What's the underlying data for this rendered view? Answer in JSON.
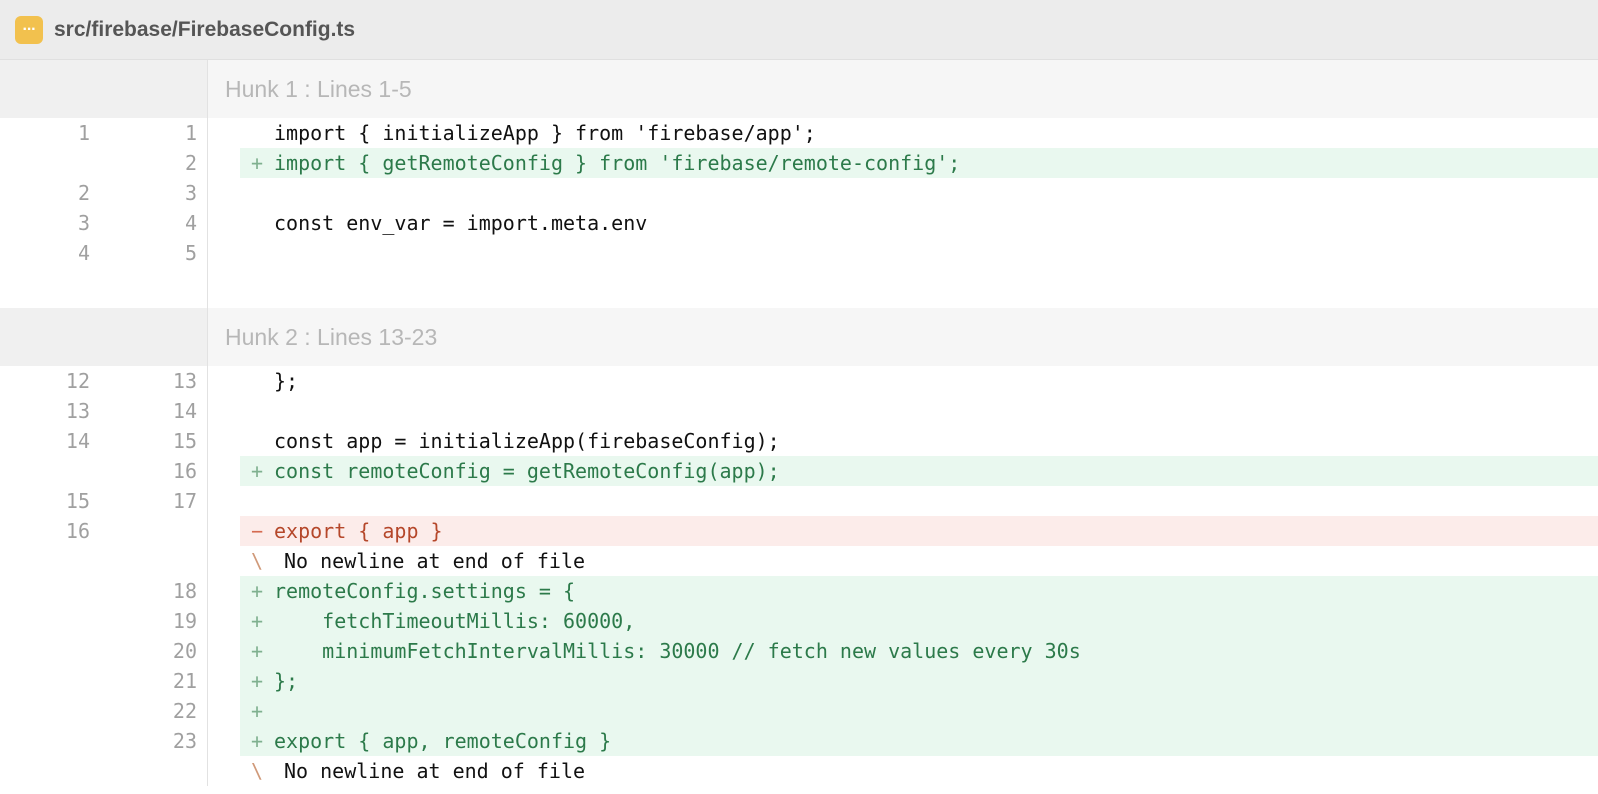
{
  "file": {
    "path": "src/firebase/FirebaseConfig.ts",
    "icon": "ellipsis-file-icon",
    "icon_glyph": "···"
  },
  "hunks": [
    {
      "title": "Hunk 1 : Lines 1-5",
      "lines": [
        {
          "type": "ctx",
          "old": "1",
          "new": "1",
          "marker": "",
          "text": "import { initializeApp } from 'firebase/app';"
        },
        {
          "type": "add",
          "old": "",
          "new": "2",
          "marker": "+",
          "text": "import { getRemoteConfig } from 'firebase/remote-config';"
        },
        {
          "type": "ctx",
          "old": "2",
          "new": "3",
          "marker": "",
          "text": ""
        },
        {
          "type": "ctx",
          "old": "3",
          "new": "4",
          "marker": "",
          "text": "const env_var = import.meta.env"
        },
        {
          "type": "ctx",
          "old": "4",
          "new": "5",
          "marker": "",
          "text": ""
        }
      ]
    },
    {
      "title": "Hunk 2 : Lines 13-23",
      "lines": [
        {
          "type": "ctx",
          "old": "12",
          "new": "13",
          "marker": "",
          "text": "};"
        },
        {
          "type": "ctx",
          "old": "13",
          "new": "14",
          "marker": "",
          "text": ""
        },
        {
          "type": "ctx",
          "old": "14",
          "new": "15",
          "marker": "",
          "text": "const app = initializeApp(firebaseConfig);"
        },
        {
          "type": "add",
          "old": "",
          "new": "16",
          "marker": "+",
          "text": "const remoteConfig = getRemoteConfig(app);"
        },
        {
          "type": "ctx",
          "old": "15",
          "new": "17",
          "marker": "",
          "text": ""
        },
        {
          "type": "del",
          "old": "16",
          "new": "",
          "marker": "−",
          "text": "export { app }"
        },
        {
          "type": "nonl",
          "old": "",
          "new": "",
          "marker": "\\",
          "text": "No newline at end of file"
        },
        {
          "type": "add",
          "old": "",
          "new": "18",
          "marker": "+",
          "text": "remoteConfig.settings = {"
        },
        {
          "type": "add",
          "old": "",
          "new": "19",
          "marker": "+",
          "text": "    fetchTimeoutMillis: 60000,"
        },
        {
          "type": "add",
          "old": "",
          "new": "20",
          "marker": "+",
          "text": "    minimumFetchIntervalMillis: 30000 // fetch new values every 30s"
        },
        {
          "type": "add",
          "old": "",
          "new": "21",
          "marker": "+",
          "text": "};"
        },
        {
          "type": "add",
          "old": "",
          "new": "22",
          "marker": "+",
          "text": ""
        },
        {
          "type": "add",
          "old": "",
          "new": "23",
          "marker": "+",
          "text": "export { app, remoteConfig }"
        },
        {
          "type": "nonl",
          "old": "",
          "new": "",
          "marker": "\\",
          "text": "No newline at end of file"
        }
      ]
    }
  ]
}
